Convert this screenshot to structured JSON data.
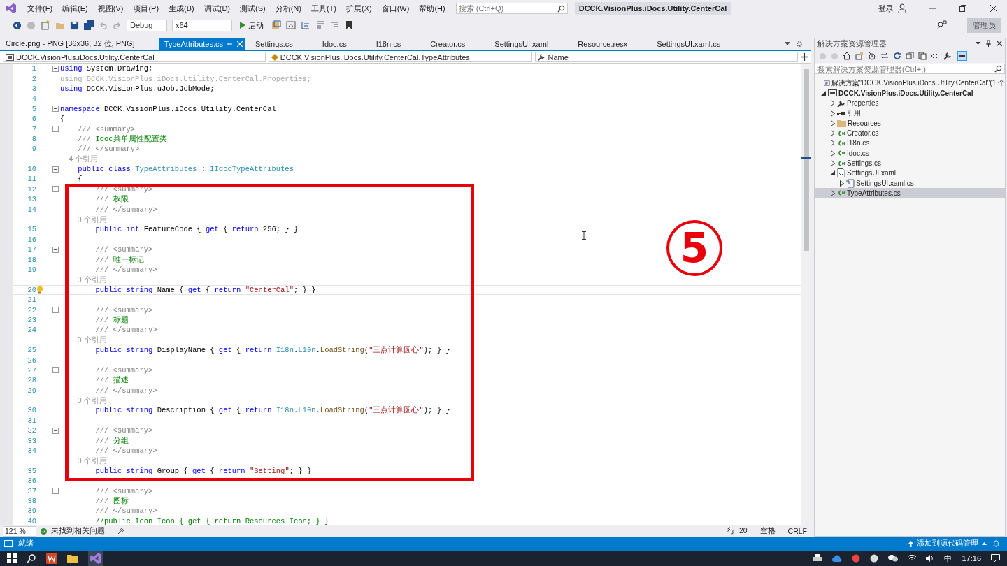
{
  "menu": [
    "文件(F)",
    "编辑(E)",
    "视图(V)",
    "项目(P)",
    "生成(B)",
    "调试(D)",
    "测试(S)",
    "分析(N)",
    "工具(T)",
    "扩展(X)",
    "窗口(W)",
    "帮助(H)"
  ],
  "search": {
    "placeholder": "搜索 (Ctrl+Q)"
  },
  "solution_name": "DCCK.VisionPlus.iDocs.Utility.CenterCal",
  "account": {
    "label": "登录"
  },
  "toolbar": {
    "configuration": "Debug",
    "platform": "x64",
    "start": "启动",
    "admin_badge": "管理员"
  },
  "tabs": [
    {
      "label": "Circle.png - PNG [36x36, 32 位, PNG]",
      "selected": false
    },
    {
      "label": "TypeAttributes.cs",
      "selected": true
    },
    {
      "label": "Settings.cs",
      "selected": false
    },
    {
      "label": "Idoc.cs",
      "selected": false
    },
    {
      "label": "I18n.cs",
      "selected": false
    },
    {
      "label": "Creator.cs",
      "selected": false
    },
    {
      "label": "SettingsUI.xaml",
      "selected": false
    },
    {
      "label": "Resource.resx",
      "selected": false
    },
    {
      "label": "SettingsUI.xaml.cs",
      "selected": false
    }
  ],
  "navigation": {
    "project": "DCCK.VisionPlus.iDocs.Utility.CenterCal",
    "type": "DCCK.VisionPlus.iDocs.Utility.CenterCal.TypeAttributes",
    "member": "Name"
  },
  "editor": {
    "lines": [
      {
        "n": "1",
        "fold": true,
        "seg": [
          {
            "kind": "keyword",
            "text": "using"
          },
          {
            "kind": "plain",
            "text": " System.Drawing;"
          }
        ]
      },
      {
        "n": "2",
        "seg": [
          {
            "kind": "unused",
            "text": "using DCCK.VisionPlus.iDocs.Utility.CenterCal.Properties;"
          }
        ]
      },
      {
        "n": "3",
        "seg": [
          {
            "kind": "keyword",
            "text": "using"
          },
          {
            "kind": "plain",
            "text": " DCCK.VisionPlus.uJob.JobMode;"
          }
        ]
      },
      {
        "n": "4"
      },
      {
        "n": "5",
        "fold": true,
        "seg": [
          {
            "kind": "keyword",
            "text": "namespace"
          },
          {
            "kind": "plain",
            "text": " DCCK.VisionPlus.iDocs.Utility.CenterCal"
          }
        ]
      },
      {
        "n": "6",
        "seg": [
          {
            "kind": "plain",
            "text": "{"
          }
        ]
      },
      {
        "n": "7",
        "fold": true,
        "seg": [
          {
            "kind": "doc",
            "text": "    /// <summary>"
          }
        ]
      },
      {
        "n": "8",
        "seg": [
          {
            "kind": "doc",
            "text": "    /// "
          },
          {
            "kind": "comment",
            "text": "Idoc菜单属性配置类"
          }
        ]
      },
      {
        "n": "9",
        "seg": [
          {
            "kind": "doc",
            "text": "    /// </summary>"
          }
        ]
      },
      {
        "ref": "    4 个引用"
      },
      {
        "n": "10",
        "fold": true,
        "seg": [
          {
            "kind": "keyword",
            "text": "    public class"
          },
          {
            "kind": "type",
            "text": " TypeAttributes"
          },
          {
            "kind": "plain",
            "text": " : "
          },
          {
            "kind": "type",
            "text": "IIdocTypeAttributes"
          }
        ]
      },
      {
        "n": "11",
        "seg": [
          {
            "kind": "plain",
            "text": "    {"
          }
        ]
      },
      {
        "n": "12",
        "fold": true,
        "seg": [
          {
            "kind": "doc",
            "text": "        /// <summary>"
          }
        ]
      },
      {
        "n": "13",
        "seg": [
          {
            "kind": "doc",
            "text": "        /// "
          },
          {
            "kind": "comment",
            "text": "权限"
          }
        ]
      },
      {
        "n": "14",
        "seg": [
          {
            "kind": "doc",
            "text": "        /// </summary>"
          }
        ]
      },
      {
        "ref": "        0 个引用"
      },
      {
        "n": "15",
        "seg": [
          {
            "kind": "keyword",
            "text": "        public int"
          },
          {
            "kind": "plain",
            "text": " FeatureCode { "
          },
          {
            "kind": "keyword",
            "text": "get"
          },
          {
            "kind": "plain",
            "text": " { "
          },
          {
            "kind": "keyword",
            "text": "return"
          },
          {
            "kind": "plain",
            "text": " 256; } }"
          }
        ]
      },
      {
        "n": "16"
      },
      {
        "n": "17",
        "fold": true,
        "seg": [
          {
            "kind": "doc",
            "text": "        /// <summary>"
          }
        ]
      },
      {
        "n": "18",
        "seg": [
          {
            "kind": "doc",
            "text": "        /// "
          },
          {
            "kind": "comment",
            "text": "唯一标记"
          }
        ]
      },
      {
        "n": "19",
        "seg": [
          {
            "kind": "doc",
            "text": "        /// </summary>"
          }
        ]
      },
      {
        "ref": "        0 个引用"
      },
      {
        "n": "20",
        "current": true,
        "lightbulb": true,
        "seg": [
          {
            "kind": "keyword",
            "text": "        public string"
          },
          {
            "kind": "plain",
            "text": " Name { "
          },
          {
            "kind": "keyword",
            "text": "get"
          },
          {
            "kind": "plain",
            "text": " { "
          },
          {
            "kind": "keyword",
            "text": "return "
          },
          {
            "kind": "string",
            "text": "\"CenterCal\""
          },
          {
            "kind": "plain",
            "text": "; } }"
          }
        ]
      },
      {
        "n": "21"
      },
      {
        "n": "22",
        "fold": true,
        "seg": [
          {
            "kind": "doc",
            "text": "        /// <summary>"
          }
        ]
      },
      {
        "n": "23",
        "seg": [
          {
            "kind": "doc",
            "text": "        /// "
          },
          {
            "kind": "comment",
            "text": "标题"
          }
        ]
      },
      {
        "n": "24",
        "seg": [
          {
            "kind": "doc",
            "text": "        /// </summary>"
          }
        ]
      },
      {
        "ref": "        0 个引用"
      },
      {
        "n": "25",
        "seg": [
          {
            "kind": "keyword",
            "text": "        public string"
          },
          {
            "kind": "plain",
            "text": " DisplayName { "
          },
          {
            "kind": "keyword",
            "text": "get"
          },
          {
            "kind": "plain",
            "text": " { "
          },
          {
            "kind": "keyword",
            "text": "return "
          },
          {
            "kind": "type",
            "text": "I18n"
          },
          {
            "kind": "plain",
            "text": "."
          },
          {
            "kind": "type",
            "text": "L10n"
          },
          {
            "kind": "plain",
            "text": "."
          },
          {
            "kind": "method",
            "text": "LoadString"
          },
          {
            "kind": "plain",
            "text": "("
          },
          {
            "kind": "string",
            "text": "\"三点计算圆心\""
          },
          {
            "kind": "plain",
            "text": "); } }"
          }
        ]
      },
      {
        "n": "26"
      },
      {
        "n": "27",
        "fold": true,
        "seg": [
          {
            "kind": "doc",
            "text": "        /// <summary>"
          }
        ]
      },
      {
        "n": "28",
        "seg": [
          {
            "kind": "doc",
            "text": "        /// "
          },
          {
            "kind": "comment",
            "text": "描述"
          }
        ]
      },
      {
        "n": "29",
        "seg": [
          {
            "kind": "doc",
            "text": "        /// </summary>"
          }
        ]
      },
      {
        "ref": "        0 个引用"
      },
      {
        "n": "30",
        "seg": [
          {
            "kind": "keyword",
            "text": "        public string"
          },
          {
            "kind": "plain",
            "text": " Description { "
          },
          {
            "kind": "keyword",
            "text": "get"
          },
          {
            "kind": "plain",
            "text": " { "
          },
          {
            "kind": "keyword",
            "text": "return "
          },
          {
            "kind": "type",
            "text": "I18n"
          },
          {
            "kind": "plain",
            "text": "."
          },
          {
            "kind": "type",
            "text": "L10n"
          },
          {
            "kind": "plain",
            "text": "."
          },
          {
            "kind": "method",
            "text": "LoadString"
          },
          {
            "kind": "plain",
            "text": "("
          },
          {
            "kind": "string",
            "text": "\"三点计算圆心\""
          },
          {
            "kind": "plain",
            "text": "); } }"
          }
        ]
      },
      {
        "n": "31"
      },
      {
        "n": "32",
        "fold": true,
        "seg": [
          {
            "kind": "doc",
            "text": "        /// <summary>"
          }
        ]
      },
      {
        "n": "33",
        "seg": [
          {
            "kind": "doc",
            "text": "        /// "
          },
          {
            "kind": "comment",
            "text": "分组"
          }
        ]
      },
      {
        "n": "34",
        "seg": [
          {
            "kind": "doc",
            "text": "        /// </summary>"
          }
        ]
      },
      {
        "ref": "        0 个引用"
      },
      {
        "n": "35",
        "seg": [
          {
            "kind": "keyword",
            "text": "        public string"
          },
          {
            "kind": "plain",
            "text": " Group { "
          },
          {
            "kind": "keyword",
            "text": "get"
          },
          {
            "kind": "plain",
            "text": " { "
          },
          {
            "kind": "keyword",
            "text": "return "
          },
          {
            "kind": "string",
            "text": "\"Setting\""
          },
          {
            "kind": "plain",
            "text": "; } }"
          }
        ]
      },
      {
        "n": "36"
      },
      {
        "n": "37",
        "fold": true,
        "seg": [
          {
            "kind": "doc",
            "text": "        /// <summary>"
          }
        ]
      },
      {
        "n": "38",
        "seg": [
          {
            "kind": "doc",
            "text": "        /// "
          },
          {
            "kind": "comment",
            "text": "图标"
          }
        ]
      },
      {
        "n": "39",
        "seg": [
          {
            "kind": "doc",
            "text": "        /// </summary>"
          }
        ]
      },
      {
        "n": "40",
        "seg": [
          {
            "kind": "comment",
            "text": "        //public Icon Icon { get { return Resources.Icon; } }"
          }
        ]
      }
    ]
  },
  "annotation": {
    "number": "5"
  },
  "editor_footer": {
    "zoom": "121 %",
    "issues": "未找到相关问题",
    "line": "行: 20",
    "whitespace": "空格",
    "line_ending": "CRLF"
  },
  "solution_explorer": {
    "title": "解决方案资源管理器",
    "search_placeholder": "搜索解决方案资源管理器(Ctrl+;)",
    "tree": [
      {
        "label": "解决方案\"DCCK.VisionPlus.iDocs.Utility.CenterCal\"(1 个",
        "kind": "solution",
        "selected": false,
        "children": [
          {
            "label": "DCCK.VisionPlus.iDocs.Utility.CenterCal",
            "kind": "project",
            "expanded": true,
            "selected": false,
            "children": [
              {
                "label": "Properties",
                "kind": "wrench",
                "expanded": false,
                "selected": false
              },
              {
                "label": "引用",
                "kind": "references",
                "expanded": false,
                "selected": false
              },
              {
                "label": "Resources",
                "kind": "folder",
                "expanded": false,
                "selected": false
              },
              {
                "label": "Creator.cs",
                "kind": "cs",
                "expanded": false,
                "selected": false
              },
              {
                "label": "I18n.cs",
                "kind": "cs",
                "expanded": false,
                "selected": false
              },
              {
                "label": "Idoc.cs",
                "kind": "cs",
                "expanded": false,
                "selected": false
              },
              {
                "label": "Settings.cs",
                "kind": "cs",
                "expanded": false,
                "selected": false
              },
              {
                "label": "SettingsUI.xaml",
                "kind": "xaml",
                "expanded": true,
                "selected": false,
                "children": [
                  {
                    "label": "SettingsUI.xaml.cs",
                    "kind": "xamlcs",
                    "expanded": false,
                    "selected": false
                  }
                ]
              },
              {
                "label": "TypeAttributes.cs",
                "kind": "cs",
                "expanded": false,
                "selected": true
              }
            ]
          }
        ]
      }
    ]
  },
  "status_bar": {
    "state": "就绪",
    "source_control": "添加到源代码管理"
  },
  "taskbar": {
    "input_method": "中",
    "time": "17:16"
  }
}
